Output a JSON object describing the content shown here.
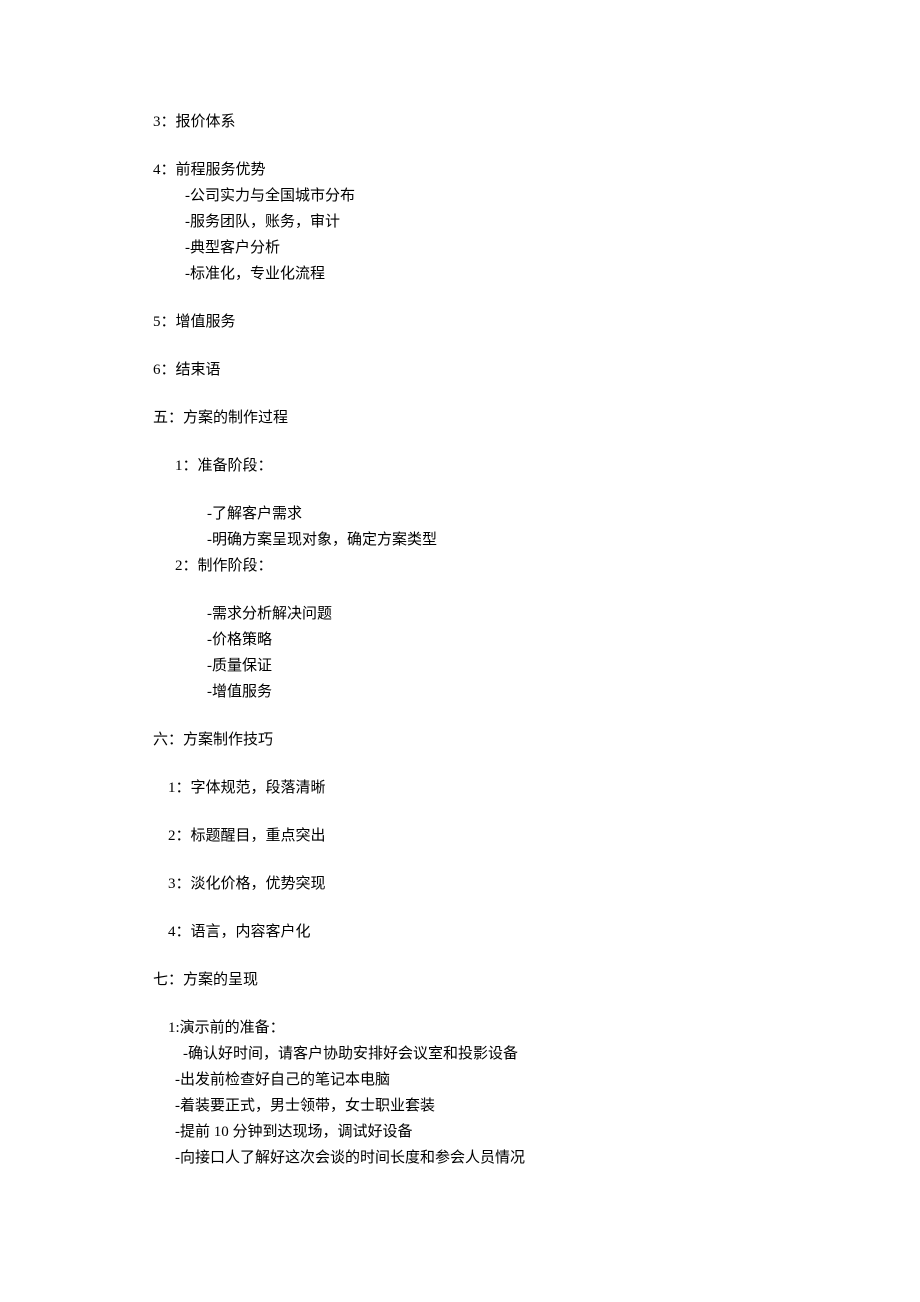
{
  "items": {
    "s3": "3：报价体系",
    "s4": "4：前程服务优势",
    "s4_1": "-公司实力与全国城市分布",
    "s4_2": "-服务团队，账务，审计",
    "s4_3": "-典型客户分析",
    "s4_4": "-标准化，专业化流程",
    "s5": "5：增值服务",
    "s6": "6：结束语",
    "h5": "五：方案的制作过程",
    "h5_1": "1：准备阶段：",
    "h5_1_1": "-了解客户需求",
    "h5_1_2": "-明确方案呈现对象，确定方案类型",
    "h5_2": "2：制作阶段：",
    "h5_2_1": " -需求分析解决问题",
    "h5_2_2": "-价格策略",
    "h5_2_3": "-质量保证",
    "h5_2_4": "-增值服务",
    "h6": "六：方案制作技巧",
    "h6_1": "1：字体规范，段落清晰",
    "h6_2": "2：标题醒目，重点突出",
    "h6_3": "3：淡化价格，优势突现",
    "h6_4": "4：语言，内容客户化",
    "h7": "七：方案的呈现",
    "h7_1": "1:演示前的准备：",
    "h7_1_1": "-确认好时间，请客户协助安排好会议室和投影设备",
    "h7_1_2": "-出发前检查好自己的笔记本电脑",
    "h7_1_3": "-着装要正式，男士领带，女士职业套装",
    "h7_1_4": "-提前 10 分钟到达现场，调试好设备",
    "h7_1_5": "-向接口人了解好这次会谈的时间长度和参会人员情况"
  }
}
